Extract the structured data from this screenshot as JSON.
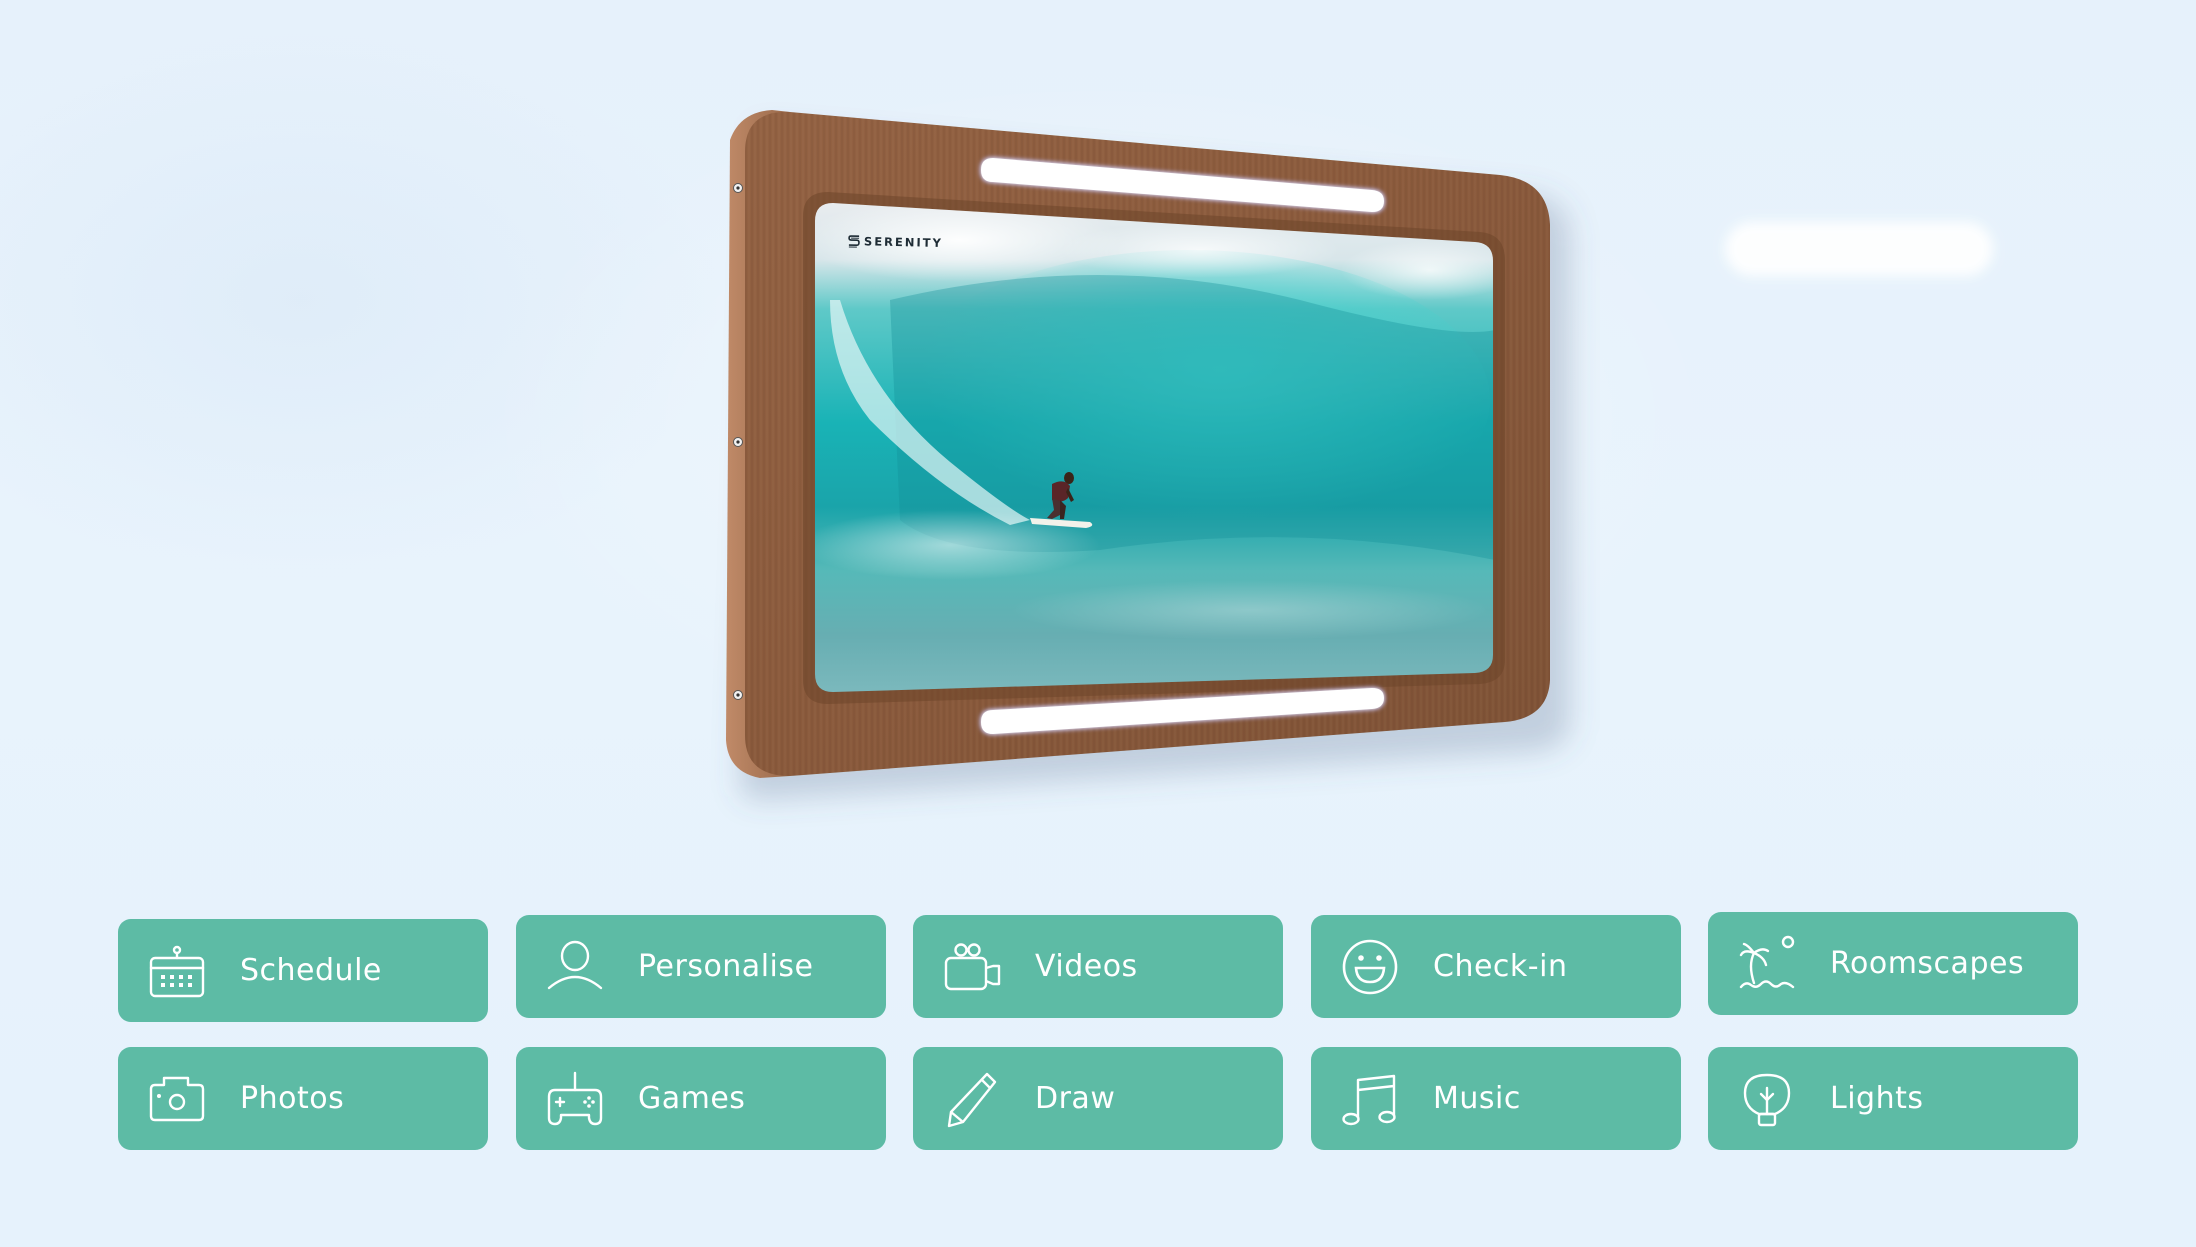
{
  "device": {
    "brand": "SERENITY",
    "screen_content": "surfer-riding-wave-photo",
    "colors": {
      "wood": "#8a5a3c",
      "wood_edge": "#b07d5c",
      "light_bar": "#ffffff",
      "wave_teal": "#1fb5b5"
    }
  },
  "tiles": [
    {
      "label": "Schedule",
      "icon": "calendar-icon"
    },
    {
      "label": "Personalise",
      "icon": "user-icon"
    },
    {
      "label": "Videos",
      "icon": "video-camera-icon"
    },
    {
      "label": "Check-in",
      "icon": "smiley-face-icon"
    },
    {
      "label": "Roomscapes",
      "icon": "palm-island-icon"
    },
    {
      "label": "Photos",
      "icon": "camera-icon"
    },
    {
      "label": "Games",
      "icon": "gamepad-icon"
    },
    {
      "label": "Draw",
      "icon": "pencil-icon"
    },
    {
      "label": "Music",
      "icon": "music-note-icon"
    },
    {
      "label": "Lights",
      "icon": "lightbulb-icon"
    }
  ],
  "theme": {
    "tile_color": "#5dbba5",
    "tile_text": "#ffffff",
    "background": "#e6f1fb"
  }
}
